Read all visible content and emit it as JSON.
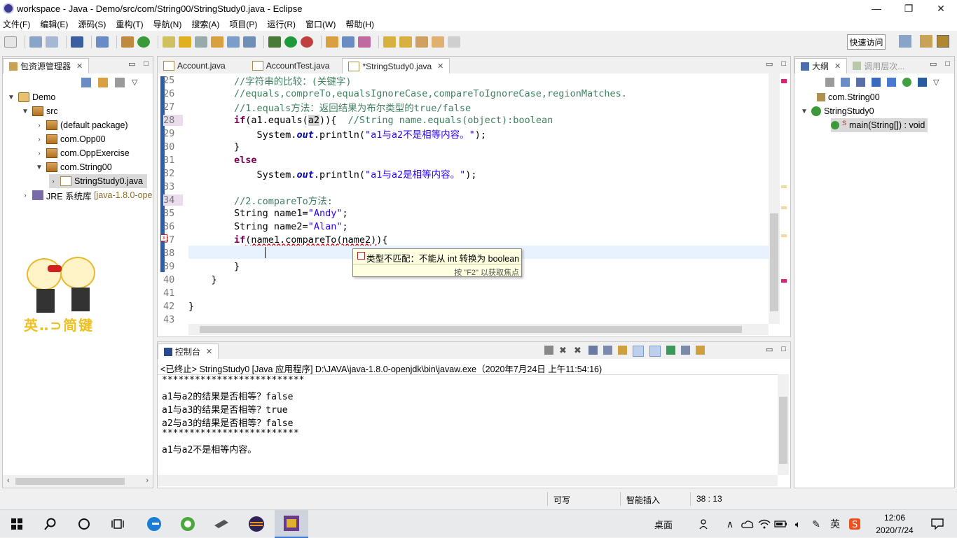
{
  "window": {
    "title": "workspace - Java - Demo/src/com/String00/StringStudy0.java - Eclipse",
    "min": "—",
    "max": "❐",
    "close": "✕"
  },
  "menu": [
    "文件(F)",
    "编辑(E)",
    "源码(S)",
    "重构(T)",
    "导航(N)",
    "搜索(A)",
    "项目(P)",
    "运行(R)",
    "窗口(W)",
    "帮助(H)"
  ],
  "toolbar": {
    "quick_access": "快速访问"
  },
  "package_explorer": {
    "tab": "包资源管理器",
    "items": [
      {
        "label": "Demo"
      },
      {
        "label": "src"
      },
      {
        "label": "(default package)"
      },
      {
        "label": "com.Opp00"
      },
      {
        "label": "com.OppExercise"
      },
      {
        "label": "com.String00"
      },
      {
        "label": "StringStudy0.java"
      },
      {
        "label": "JRE 系统库",
        "extra": "[java-1.8.0-ope"
      }
    ],
    "watermark": "英‥⊃简键"
  },
  "editor": {
    "tabs": [
      {
        "label": "Account.java"
      },
      {
        "label": "AccountTest.java"
      },
      {
        "label": "*StringStudy0.java"
      }
    ],
    "lines": [
      {
        "n": "25",
        "html": "        <span class='cm'>//字符串的比较：(关键字)</span>"
      },
      {
        "n": "26",
        "html": "        <span class='cm'>//equals,compreTo,equalsIgnoreCase,compareToIgnoreCase,regionMatches.</span>"
      },
      {
        "n": "27",
        "html": "        <span class='cm'>//1.equals方法：返回结果为布尔类型的true/false</span>"
      },
      {
        "n": "28",
        "html": "        <span class='kw'>if</span>(a1.equals(<span style='background:#d4d4d4'>a2</span>)){  <span class='cm'>//String name.equals(object):boolean</span>"
      },
      {
        "n": "29",
        "html": "            System.<span class='fld'>out</span>.println(<span class='st'>\"a1与a2不是相等内容。\"</span>);"
      },
      {
        "n": "30",
        "html": "        }"
      },
      {
        "n": "31",
        "html": "        <span class='kw'>else</span>"
      },
      {
        "n": "32",
        "html": "            System.<span class='fld'>out</span>.println(<span class='st'>\"a1与a2是相等内容。\"</span>);"
      },
      {
        "n": "33",
        "html": ""
      },
      {
        "n": "34",
        "html": "        <span class='cm'>//2.compareTo方法:</span>"
      },
      {
        "n": "35",
        "html": "        String name1=<span class='st'>\"Andy\"</span>;"
      },
      {
        "n": "36",
        "html": "        String name2=<span class='st'>\"Alan\"</span>;"
      },
      {
        "n": "37",
        "html": "        <span class='kw'>if</span><span class='err'>(name1.compareTo(name2)</span>){"
      },
      {
        "n": "38",
        "html": "            "
      },
      {
        "n": "39",
        "html": "        }"
      },
      {
        "n": "40",
        "html": "    }"
      },
      {
        "n": "41",
        "html": ""
      },
      {
        "n": "42",
        "html": "}"
      },
      {
        "n": "43",
        "html": ""
      }
    ],
    "tooltip": {
      "message": "类型不匹配：不能从 int 转换为 boolean",
      "hint": "按 \"F2\" 以获取焦点"
    }
  },
  "outline": {
    "tab": "大纲",
    "tab2": "调用层次...",
    "items": [
      {
        "label": "com.String00"
      },
      {
        "label": "StringStudy0"
      },
      {
        "label": "main(String[]) : void"
      }
    ]
  },
  "console": {
    "tab": "控制台",
    "header": "<已终止> StringStudy0 [Java 应用程序] D:\\JAVA\\java-1.8.0-openjdk\\bin\\javaw.exe（2020年7月24日 上午11:54:16)",
    "lines": [
      "**************************",
      "a1与a2的结果是否相等？false",
      "a1与a3的结果是否相等？true",
      "a2与a3的结果是否相等？false",
      "*************************",
      "a1与a2不是相等内容。"
    ]
  },
  "status": {
    "writable": "可写",
    "insert_mode": "智能插入",
    "position": "38 : 13"
  },
  "taskbar": {
    "desktop": "桌面",
    "ime": "英",
    "time": "12:06",
    "date": "2020/7/24"
  }
}
